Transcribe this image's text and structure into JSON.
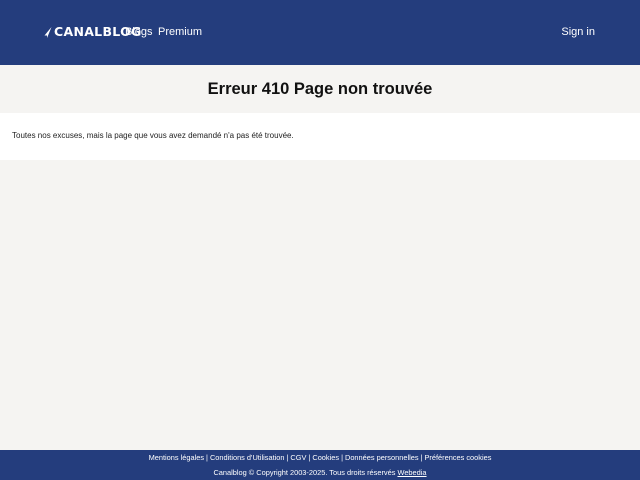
{
  "header": {
    "logo_text": "CANALBLOG",
    "logo_icon": "canalblog-logo-icon",
    "nav_blogs": "Blogs",
    "nav_premium": "Premium",
    "sign_in": "Sign in",
    "bg_color": "#243d7d"
  },
  "main": {
    "title": "Erreur 410 Page non trouvée",
    "message": "Toutes nos excuses, mais la page que vous avez demandé n'a pas été trouvée."
  },
  "footer": {
    "links": [
      "Mentions légales",
      "Conditions d'Utilisation",
      "CGV",
      "Cookies",
      "Données personnelles",
      "Préférences cookies"
    ],
    "separator": "|",
    "copyright": "Canalblog © Copyright 2003-2025. Tous droits réservés",
    "owner_link": "Webedia"
  }
}
